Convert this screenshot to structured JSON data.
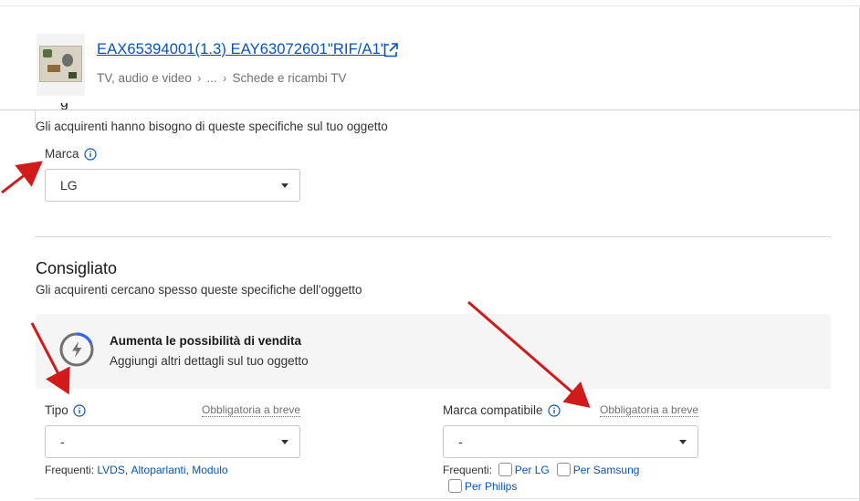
{
  "header": {
    "item_title": "EAX65394001(1.3) EAY63072601\"RIF/A1\"",
    "breadcrumb": [
      "TV, audio e video",
      "...",
      "Schede e ricambi TV"
    ]
  },
  "required": {
    "section_title_cut": "g",
    "subtitle": "Gli acquirenti hanno bisogno di queste specifiche sul tuo oggetto",
    "brand_label": "Marca",
    "brand_value": "LG"
  },
  "recommended": {
    "title": "Consigliato",
    "subtitle": "Gli acquirenti cercano spesso queste specifiche dell'oggetto",
    "promo_title": "Aumenta le possibilità di vendita",
    "promo_subtitle": "Aggiungi altri dettagli sul tuo oggetto",
    "type_label": "Tipo",
    "type_value": "-",
    "type_soon": "Obbligatoria a breve",
    "type_frequent_label": "Frequenti:",
    "type_frequent": [
      "LVDS",
      "Altoparlanti",
      "Modulo"
    ],
    "compat_label": "Marca compatibile",
    "compat_value": "-",
    "compat_soon": "Obbligatoria a breve",
    "compat_frequent_label": "Frequenti:",
    "compat_frequent": [
      "Per LG",
      "Per Samsung",
      "Per Philips"
    ]
  },
  "colors": {
    "link": "#0654ba",
    "annotation_arrow": "#d11a1a",
    "promo_ring": "#3665f3"
  },
  "icons": [
    "external-link-icon",
    "info-icon",
    "chevron-right-icon",
    "dropdown-caret-icon",
    "lightning-gauge-icon",
    "checkbox-icon",
    "annotation-arrow"
  ]
}
